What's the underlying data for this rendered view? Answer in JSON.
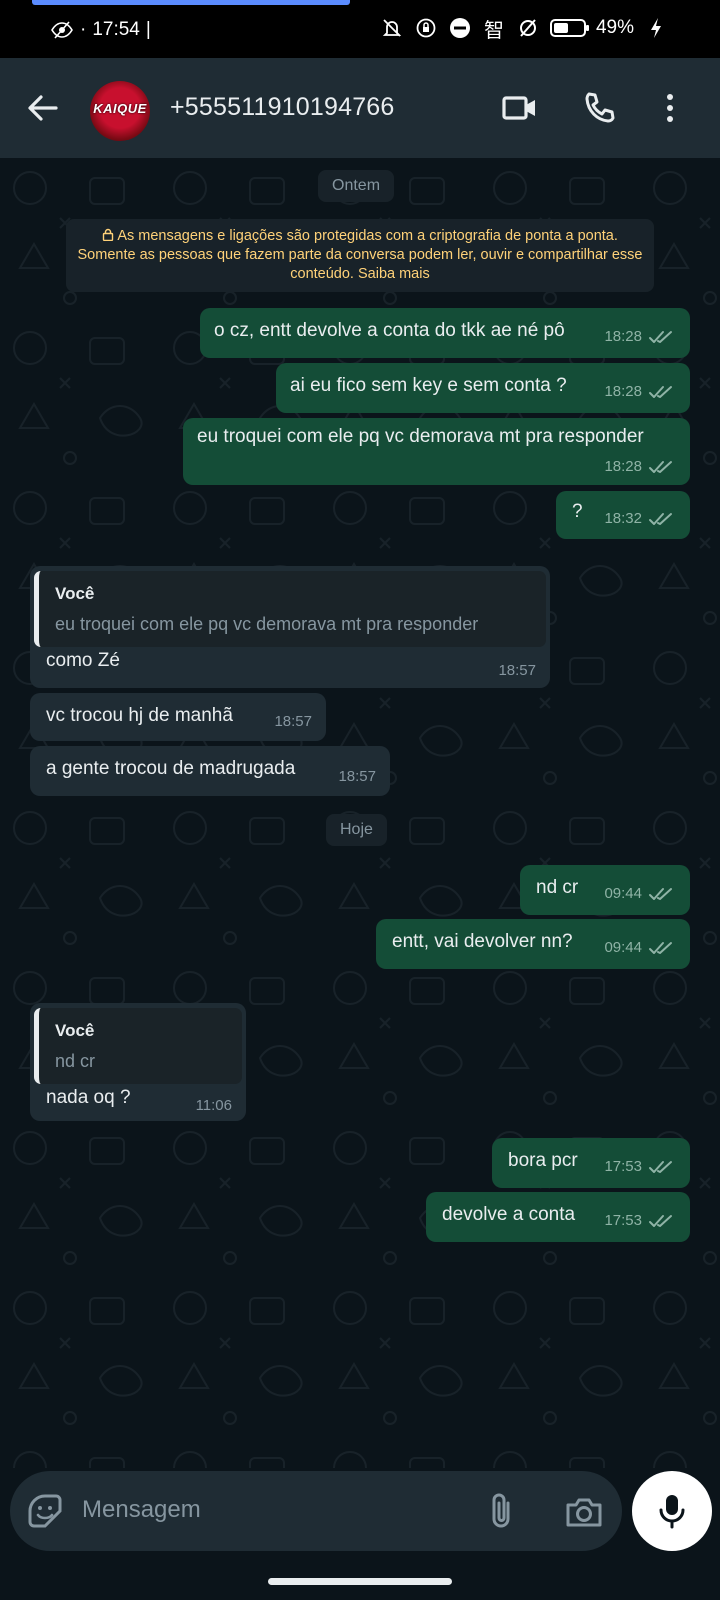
{
  "status_bar": {
    "time": "17:54",
    "battery": "49%",
    "battery_level": 0.49,
    "icons": [
      "eye-icon",
      "mute-icon",
      "rotation-lock-icon",
      "dnd-icon",
      "smart-icon",
      "no-data-icon",
      "battery-icon",
      "charging-icon"
    ]
  },
  "header": {
    "contact": "+555511910194766",
    "avatar_text": "KAIQUE"
  },
  "chat": {
    "date_yesterday": "Ontem",
    "encryption_notice": "As mensagens e ligações são protegidas com a criptografia de ponta a ponta. Somente as pessoas que fazem parte da conversa podem ler, ouvir e compartilhar esse conteúdo. Saiba mais",
    "date_today": "Hoje",
    "messages": [
      {
        "direction": "out",
        "text": "o cz, entt devolve a conta do tkk ae né pô",
        "time": "18:28",
        "status": "read"
      },
      {
        "direction": "out",
        "text": "ai eu fico sem key e sem conta ?",
        "time": "18:28",
        "status": "read"
      },
      {
        "direction": "out",
        "text": "eu troquei com ele pq vc demorava mt pra responder",
        "time": "18:28",
        "status": "read"
      },
      {
        "direction": "out",
        "text": "?",
        "time": "18:32",
        "status": "read"
      },
      {
        "direction": "in",
        "quote_author": "Você",
        "quote_text": "eu troquei com ele pq vc demorava mt pra responder",
        "text": "como Zé",
        "time": "18:57"
      },
      {
        "direction": "in",
        "text": "vc trocou hj de manhã",
        "time": "18:57"
      },
      {
        "direction": "in",
        "text": "a gente trocou de madrugada",
        "time": "18:57"
      },
      {
        "direction": "out",
        "text": "nd cr",
        "time": "09:44",
        "status": "read"
      },
      {
        "direction": "out",
        "text": "entt, vai devolver nn?",
        "time": "09:44",
        "status": "read"
      },
      {
        "direction": "in",
        "quote_author": "Você",
        "quote_text": "nd cr",
        "text": "nada oq ?",
        "time": "11:06"
      },
      {
        "direction": "out",
        "text": "bora pcr",
        "time": "17:53",
        "status": "read"
      },
      {
        "direction": "out",
        "text": "devolve a conta",
        "time": "17:53",
        "status": "read"
      }
    ]
  },
  "composer": {
    "placeholder": "Mensagem"
  },
  "colors": {
    "background": "#0b141a",
    "header": "#1f2c34",
    "outgoing_bubble": "#144d37",
    "incoming_bubble": "#1f2c34",
    "read_tick": "#8fb3a6",
    "notice_text": "#ffd279"
  }
}
